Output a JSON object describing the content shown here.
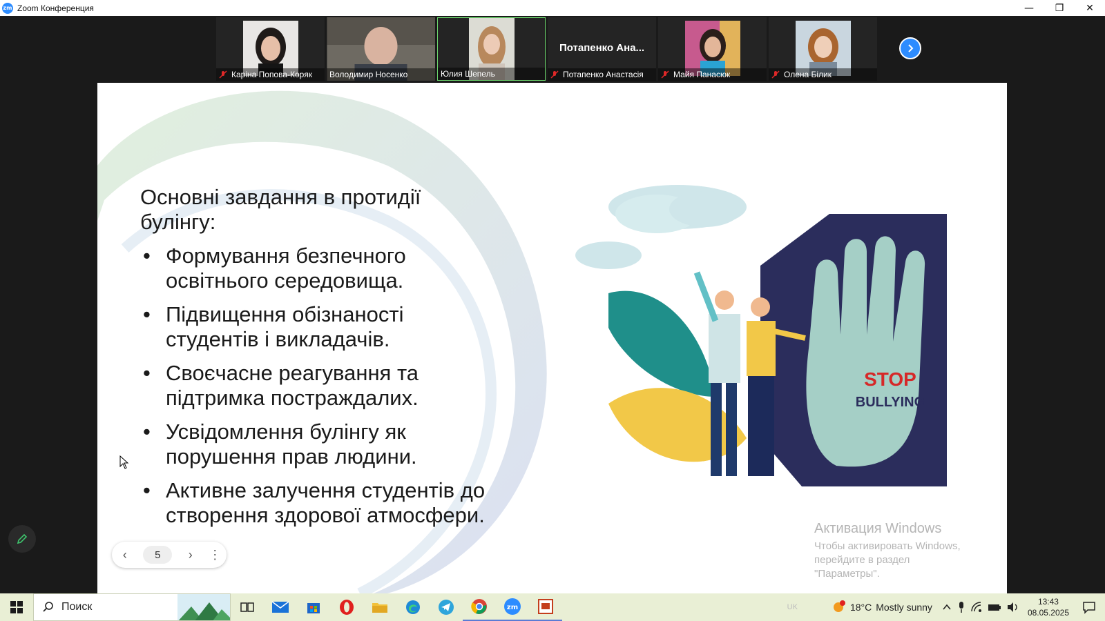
{
  "window": {
    "app_logo": "zm",
    "title": "Zoom Конференция",
    "minimize": "—",
    "restore": "❐",
    "close": "✕"
  },
  "participants": [
    {
      "name": "Каріна Попова-Коряк",
      "muted": true
    },
    {
      "name": "Володимир Носенко",
      "muted": false
    },
    {
      "name": "Юлия Шепель",
      "muted": false,
      "active_speaker": true
    },
    {
      "name": "Потапенко Анастасія",
      "muted": true,
      "display_label": "Потапенко  Ана..."
    },
    {
      "name": "Майя Панасюк",
      "muted": true
    },
    {
      "name": "Олена Білик",
      "muted": true
    }
  ],
  "slide": {
    "heading": "Основні завдання в протидії булінгу:",
    "bullets": [
      "Формування безпечного освітнього середовища.",
      "Підвищення обізнаності студентів і викладачів.",
      "Своєчасне реагування та підтримка постраждалих.",
      "Усвідомлення булінгу як порушення прав людини.",
      "Активне залучення студентів до створення здорової атмосфери."
    ],
    "image_text_1": "STOP",
    "image_text_2": "BULLYING",
    "page_number": "5",
    "nav_prev": "‹",
    "nav_next": "›",
    "nav_more": "⋮"
  },
  "activation": {
    "title": "Активация Windows",
    "line1": "Чтобы активировать Windows, перейдите в раздел",
    "line2": "\"Параметры\"."
  },
  "taskbar": {
    "search_label": "Поиск",
    "lang": "UK",
    "weather_temp": "18°C",
    "weather_desc": "Mostly sunny",
    "time": "13:43",
    "date": "08.05.2025",
    "apps": [
      "task-view",
      "mail",
      "store",
      "opera",
      "file-explorer",
      "edge",
      "telegram",
      "chrome",
      "zoom",
      "powerpoint"
    ]
  },
  "colors": {
    "zoom_blue": "#2d8cff",
    "active_border": "#6bd36b",
    "stop_red": "#d62828",
    "hand": "#a5cfc6",
    "navy": "#2b2d5c"
  }
}
